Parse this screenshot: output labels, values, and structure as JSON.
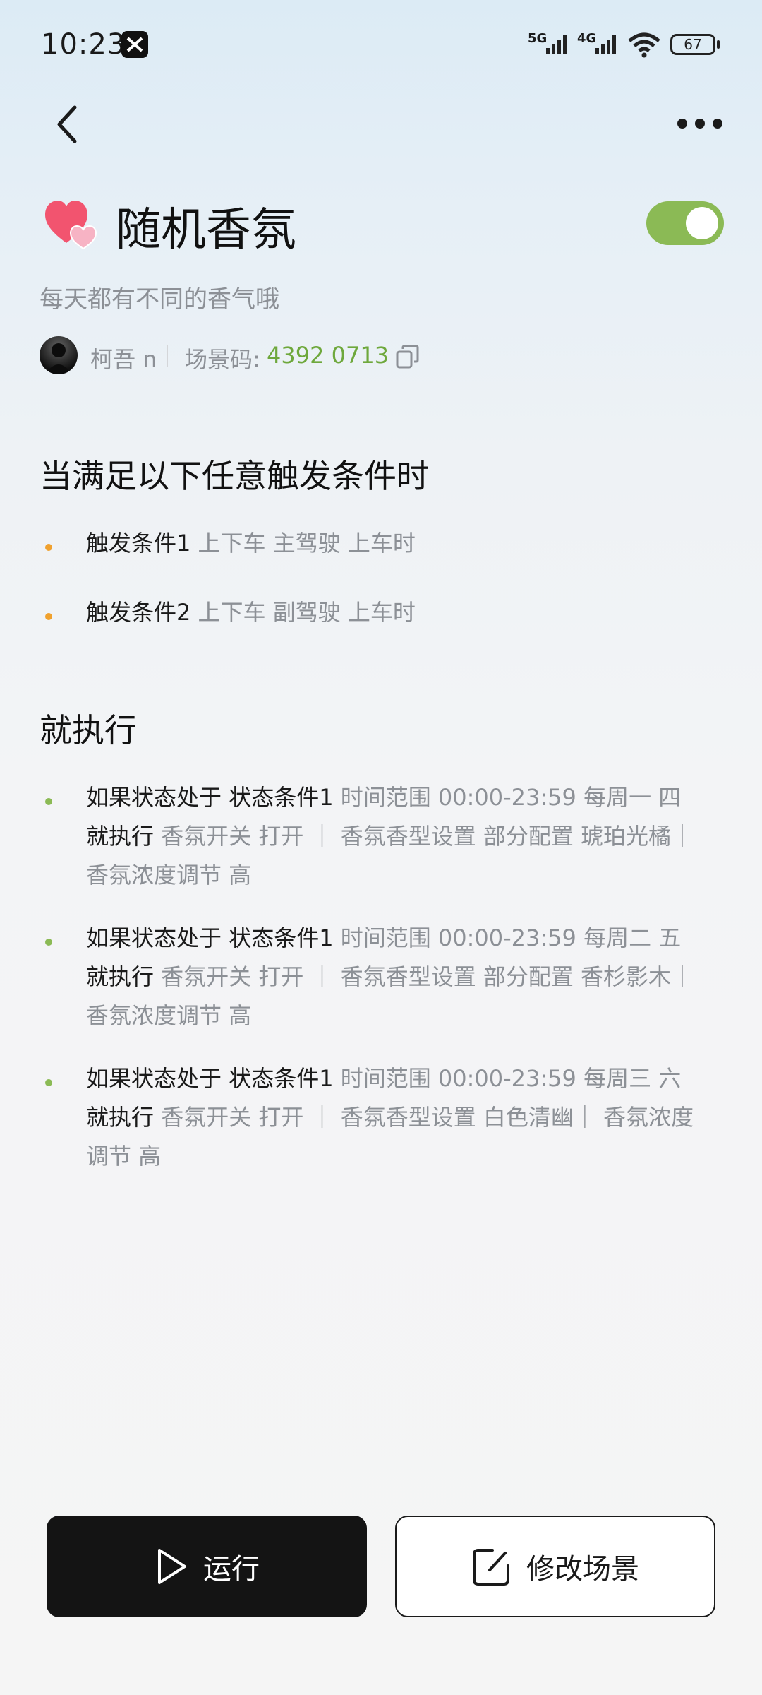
{
  "status_bar": {
    "time": "10:23",
    "net1": "5G",
    "net2": "4G",
    "battery": "67"
  },
  "scene": {
    "title": "随机香氛",
    "subtitle": "每天都有不同的香气哦",
    "author": "柯吾 n",
    "code_label": "场景码:",
    "code": "4392 0713",
    "enabled": true
  },
  "triggers": {
    "heading": "当满足以下任意触发条件时",
    "items": [
      {
        "label": "触发条件1",
        "value": "上下车 主驾驶 上车时"
      },
      {
        "label": "触发条件2",
        "value": "上下车 副驾驶 上车时"
      }
    ]
  },
  "actions": {
    "heading": "就执行",
    "items": [
      {
        "if_label": "如果状态处于",
        "cond_label": "状态条件1",
        "cond_value": "时间范围 00:00-23:59 每周一 四",
        "do_label": "就执行",
        "line2": "香氛开关 打开 ｜ 香氛香型设置 部分配置 琥珀光橘｜",
        "line3": "香氛浓度调节 高"
      },
      {
        "if_label": "如果状态处于",
        "cond_label": "状态条件1",
        "cond_value": "时间范围 00:00-23:59 每周二 五",
        "do_label": "就执行",
        "line2": "香氛开关 打开 ｜ 香氛香型设置 部分配置 香杉影木｜",
        "line3": "香氛浓度调节 高"
      },
      {
        "if_label": "如果状态处于",
        "cond_label": "状态条件1",
        "cond_value": "时间范围 00:00-23:59 每周三 六",
        "do_label": "就执行",
        "line2": "香氛开关 打开 ｜ 香氛香型设置 白色清幽｜ 香氛浓度",
        "line3": "调节 高"
      }
    ]
  },
  "buttons": {
    "run": "运行",
    "edit": "修改场景"
  },
  "colors": {
    "accent_green": "#8bba55",
    "code_green": "#6ea83c",
    "bullet_orange": "#f0a12e"
  },
  "icons": [
    "back-icon",
    "more-icon",
    "heart-icon",
    "copy-icon",
    "play-icon",
    "edit-icon"
  ]
}
